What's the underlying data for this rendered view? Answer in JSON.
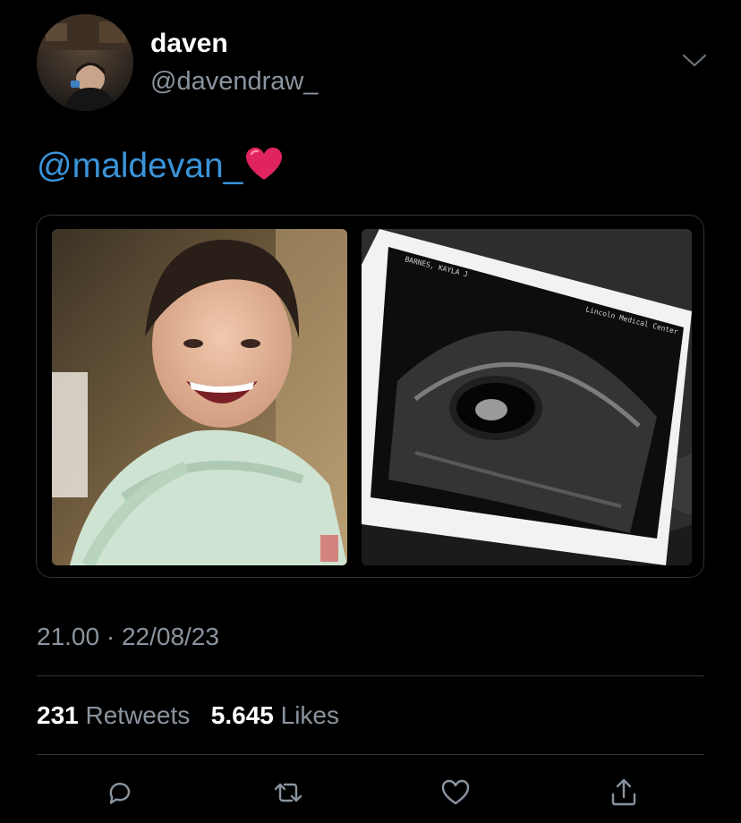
{
  "tweet": {
    "author": {
      "display_name": "daven",
      "handle": "@davendraw_",
      "avatar_icon": "profile-photo"
    },
    "menu_icon": "chevron-down-icon",
    "text": {
      "mention": "@maldevan_",
      "emoji": "red-heart-emoji"
    },
    "media": [
      {
        "icon": "photo-smiling-person"
      },
      {
        "icon": "photo-ultrasound-scan"
      }
    ],
    "timestamp": "21.00 · 22/08/23",
    "stats": {
      "retweets_count": "231",
      "retweets_label": "Retweets",
      "likes_count": "5.645",
      "likes_label": "Likes"
    },
    "actions": [
      {
        "icon": "reply-icon"
      },
      {
        "icon": "retweet-icon"
      },
      {
        "icon": "like-icon"
      },
      {
        "icon": "share-icon"
      }
    ]
  },
  "colors": {
    "background": "#000000",
    "text_primary": "#ffffff",
    "text_secondary": "#8a949e",
    "mention": "#3b94d9",
    "divider": "#2f3336",
    "heart": "#e0245e"
  }
}
